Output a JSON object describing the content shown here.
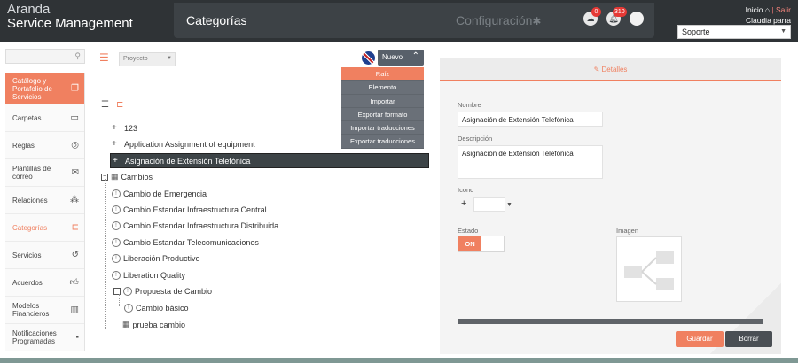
{
  "header": {
    "brand_line1": "Aranda",
    "brand_line2": "Service Management",
    "section_title": "Categorías",
    "config_label": "Configuración",
    "cloud_badge": "0",
    "bell_badge": "310",
    "inicio": "Inicio",
    "salir": "Salir",
    "user_name": "Claudia parra",
    "selector_value": "Soporte"
  },
  "sidebar": {
    "items": [
      {
        "label": "Catálogo y Portafolio de Servicios"
      },
      {
        "label": "Carpetas"
      },
      {
        "label": "Reglas"
      },
      {
        "label": "Plantillas de correo"
      },
      {
        "label": "Relaciones"
      },
      {
        "label": "Categorías"
      },
      {
        "label": "Servicios"
      },
      {
        "label": "Acuerdos"
      },
      {
        "label": "Modelos Financieros"
      },
      {
        "label": "Notificaciones Programadas"
      }
    ]
  },
  "toolbar": {
    "project_placeholder": "Proyecto",
    "nuevo_label": "Nuevo"
  },
  "dropdown": {
    "items": [
      "Raíz",
      "Elemento",
      "Importar",
      "Exportar formato",
      "Importar traducciones",
      "Exportar traducciones"
    ]
  },
  "tree": {
    "items": [
      "123",
      "Application Assignment of equipment",
      "Asignación de Extensión Telefónica",
      "Cambios",
      "Cambio de Emergencia",
      "Cambio Estandar Infraestructura Central",
      "Cambio Estandar Infraestructura Distribuida",
      "Cambio Estandar Telecomunicaciones",
      "Liberación Productivo",
      "Liberation Quality",
      "Propuesta de Cambio",
      "Cambio básico",
      "prueba cambio"
    ]
  },
  "details": {
    "tab_label": "Detalles",
    "nombre_label": "Nombre",
    "nombre_value": "Asignación de Extensión Telefónica",
    "descripcion_label": "Descripción",
    "descripcion_value": "Asignación de Extensión Telefónica",
    "icono_label": "Icono",
    "estado_label": "Estado",
    "estado_on": "ON",
    "imagen_label": "Imagen"
  },
  "actions": {
    "guardar": "Guardar",
    "borrar": "Borrar"
  }
}
